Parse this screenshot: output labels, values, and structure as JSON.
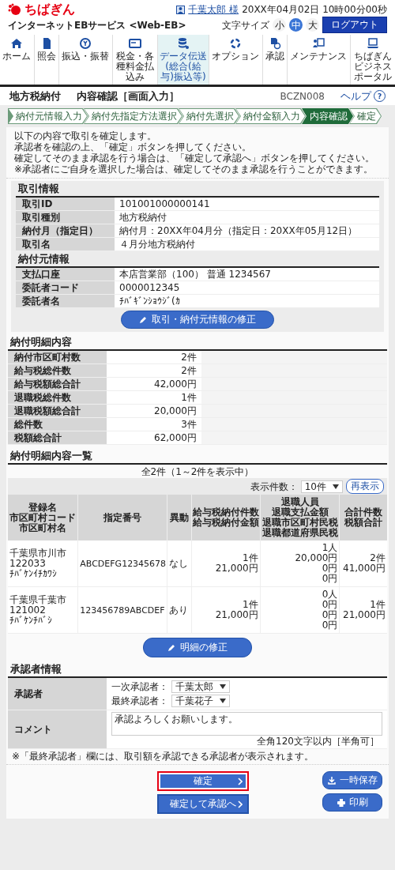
{
  "header": {
    "logo": "ちばぎん",
    "service": "インターネットEBサービス <Web-EB>",
    "user": "千葉太郎 様",
    "datetime": "20XX年04月02日 10時00分00秒",
    "font_size_label": "文字サイズ",
    "font_sizes": [
      {
        "label": "小",
        "selected": false
      },
      {
        "label": "中",
        "selected": true
      },
      {
        "label": "大",
        "selected": false
      }
    ],
    "logout": "ログアウト"
  },
  "nav": [
    {
      "label": "ホーム",
      "selected": false
    },
    {
      "label": "照会",
      "selected": false
    },
    {
      "label": "振込・振替",
      "selected": false
    },
    {
      "label": "税金・各種料金払込み",
      "selected": false
    },
    {
      "label": "データ伝送",
      "sub": "(総合(給与)振込等)",
      "selected": true
    },
    {
      "label": "オプション",
      "selected": false
    },
    {
      "label": "承認",
      "selected": false
    },
    {
      "label": "メンテナンス",
      "selected": false
    },
    {
      "label": "ちばぎんビジネスポータル",
      "selected": false
    }
  ],
  "page": {
    "title": "地方税納付",
    "subtitle": "内容確認［画面入力］",
    "screen_id": "BCZN008",
    "help": "ヘルプ",
    "help_mark": "?"
  },
  "steps": [
    {
      "label": "納付元情報入力",
      "selected": false
    },
    {
      "label": "納付先指定方法選択",
      "selected": false
    },
    {
      "label": "納付先選択",
      "selected": false
    },
    {
      "label": "納付金額入力",
      "selected": false
    },
    {
      "label": "内容確認",
      "selected": true
    },
    {
      "label": "確定",
      "selected": false
    }
  ],
  "intro": [
    "以下の内容で取引を確定します。",
    "承認者を確認の上、「確定」ボタンを押してください。",
    "確定してそのまま承認を行う場合は、「確定して承認へ」ボタンを押してください。",
    "※承認者にご自身を選択した場合は、確定してそのまま承認を行うことができます。"
  ],
  "transaction": {
    "title": "取引情報",
    "rows": [
      {
        "label": "取引ID",
        "value": "101001000000141"
      },
      {
        "label": "取引種別",
        "value": "地方税納付"
      },
      {
        "label": "納付月（指定日）",
        "value": "納付月：20XX年04月分（指定日：20XX年05月12日）"
      },
      {
        "label": "取引名",
        "value": "４月分地方税納付"
      }
    ]
  },
  "payer": {
    "title": "納付元情報",
    "rows": [
      {
        "label": "支払口座",
        "value": "本店営業部（100） 普通 1234567"
      },
      {
        "label": "委託者コード",
        "value": "0000012345"
      },
      {
        "label": "委託者名",
        "value": "ﾁﾊﾞｷﾞﾝｼｮｳｼﾞ(ｶ"
      }
    ],
    "edit_button": "取引・納付元情報の修正"
  },
  "summary": {
    "title": "納付明細内容",
    "rows": [
      {
        "label": "納付市区町村数",
        "value": "2件"
      },
      {
        "label": "給与税総件数",
        "value": "2件"
      },
      {
        "label": "給与税額総合計",
        "value": "42,000円"
      },
      {
        "label": "退職税総件数",
        "value": "1件"
      },
      {
        "label": "退職税額総合計",
        "value": "20,000円"
      },
      {
        "label": "総件数",
        "value": "3件"
      },
      {
        "label": "税額総合計",
        "value": "62,000円"
      }
    ]
  },
  "detail_list": {
    "title": "納付明細内容一覧",
    "count": "全2件（1～2件を表示中）",
    "per_page_label": "表示件数：",
    "per_page": "10件",
    "redisplay": "再表示",
    "columns": [
      {
        "lines": [
          "登録名",
          "市区町村コード",
          "市区町村名"
        ]
      },
      {
        "lines": [
          "指定番号"
        ]
      },
      {
        "lines": [
          "異動"
        ]
      },
      {
        "lines": [
          "給与税納付件数",
          "給与税納付金額"
        ]
      },
      {
        "lines": [
          "退職人員",
          "退職支払金額",
          "退職市区町村民税",
          "退職都道府県民税"
        ]
      },
      {
        "lines": [
          "合計件数",
          "税額合計"
        ]
      }
    ],
    "rows": [
      {
        "cells": [
          {
            "lines": [
              "千葉県市川市",
              "122033",
              "ﾁﾊﾞｹﾝｲﾁｶﾜｼ"
            ]
          },
          {
            "lines": [
              "ABCDEFG12345678"
            ]
          },
          {
            "lines": [
              "なし"
            ]
          },
          {
            "lines": [
              "1件",
              "21,000円"
            ]
          },
          {
            "lines": [
              "1人",
              "20,000円",
              "0円",
              "0円"
            ]
          },
          {
            "lines": [
              "2件",
              "41,000円"
            ]
          }
        ]
      },
      {
        "cells": [
          {
            "lines": [
              "千葉県千葉市",
              "121002",
              "ﾁﾊﾞｹﾝﾁﾊﾞｼ"
            ]
          },
          {
            "lines": [
              "123456789ABCDEF"
            ]
          },
          {
            "lines": [
              "あり"
            ]
          },
          {
            "lines": [
              "1件",
              "21,000円"
            ]
          },
          {
            "lines": [
              "0人",
              "0円",
              "0円",
              "0円"
            ]
          },
          {
            "lines": [
              "1件",
              "21,000円"
            ]
          }
        ]
      }
    ],
    "edit_button": "明細の修正"
  },
  "approver": {
    "title": "承認者情報",
    "approver_label": "承認者",
    "first_label": "一次承認者：",
    "first_value": "千葉太郎",
    "final_label": "最終承認者：",
    "final_value": "千葉花子",
    "comment_label": "コメント",
    "comment": "承認よろしくお願いします。",
    "comment_hint": "全角120文字以内［半角可］",
    "note": "※「最終承認者」欄には、取引額を承認できる承認者が表示されます。"
  },
  "primary_buttons": [
    {
      "label": "確定",
      "highlighted": true
    },
    {
      "label": "確定して承認へ",
      "highlighted": false
    }
  ],
  "side_buttons": [
    {
      "label": "一時保存",
      "kind": "save"
    },
    {
      "label": "印刷",
      "kind": "print"
    }
  ]
}
